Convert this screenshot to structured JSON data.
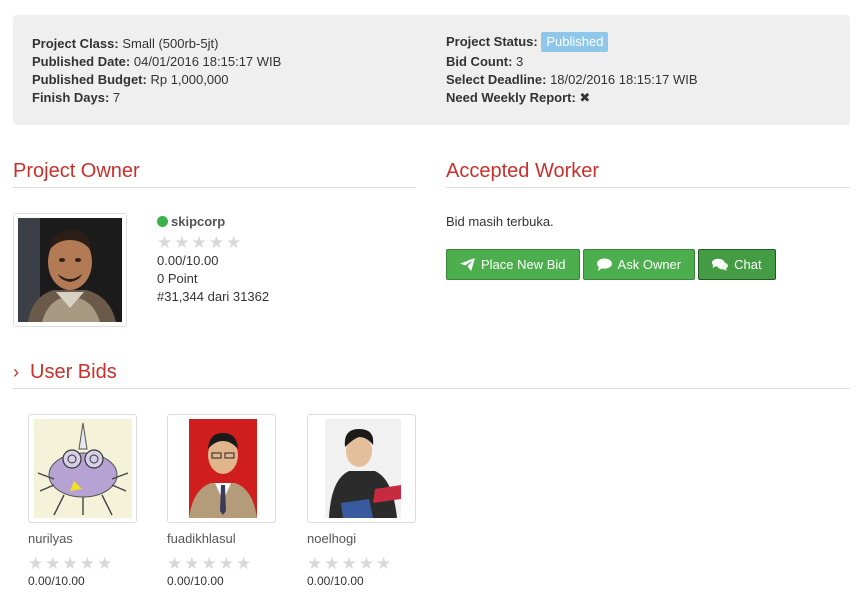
{
  "info": {
    "left": [
      {
        "label": "Project Class:",
        "value": "Small (500rb-5jt)"
      },
      {
        "label": "Published Date:",
        "value": "04/01/2016 18:15:17 WIB"
      },
      {
        "label": "Published Budget:",
        "value": "Rp 1,000,000"
      },
      {
        "label": "Finish Days:",
        "value": "7"
      }
    ],
    "status_label": "Project Status:",
    "status_value": "Published",
    "right": [
      {
        "label": "Bid Count:",
        "value": "3"
      },
      {
        "label": "Select Deadline:",
        "value": "18/02/2016 18:15:17 WIB"
      }
    ],
    "weekly_label": "Need Weekly Report:",
    "weekly_icon": "✖"
  },
  "owner": {
    "title": "Project Owner",
    "name": "skipcorp",
    "rating": "0.00/10.00",
    "points": "0 Point",
    "rank": "#31,344 dari 31362",
    "rating_stars_filled": 0,
    "status_color": "#3cb34a"
  },
  "worker": {
    "title": "Accepted Worker",
    "message": "Bid masih terbuka.",
    "buttons": [
      {
        "label": "Place New Bid",
        "icon": "paper-plane-icon"
      },
      {
        "label": "Ask Owner",
        "icon": "comment-icon"
      },
      {
        "label": "Chat",
        "icon": "comments-icon"
      }
    ]
  },
  "bids": {
    "title": "User Bids",
    "users": [
      {
        "name": "nurilyas",
        "rating": "0.00/10.00"
      },
      {
        "name": "fuadikhlasul",
        "rating": "0.00/10.00"
      },
      {
        "name": "noelhogi",
        "rating": "0.00/10.00"
      }
    ]
  },
  "colors": {
    "accent": "#c9302c",
    "button": "#4cae4c",
    "badge": "#8fc7ea",
    "panel": "#efefef"
  }
}
